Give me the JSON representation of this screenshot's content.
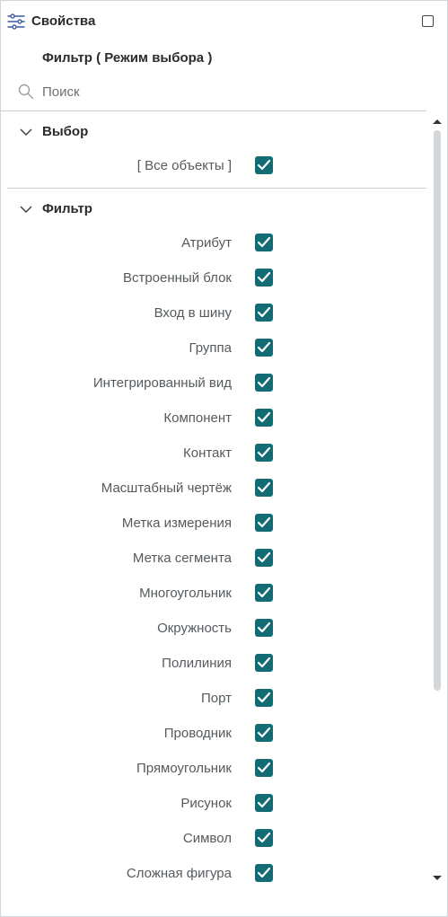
{
  "header": {
    "title": "Свойства",
    "subtitle": "Фильтр ( Режим выбора )"
  },
  "search": {
    "placeholder": "Поиск",
    "value": ""
  },
  "sections": {
    "selection": {
      "title": "Выбор",
      "items": [
        {
          "label": "[ Все объекты ]",
          "checked": true
        }
      ]
    },
    "filter": {
      "title": "Фильтр",
      "items": [
        {
          "label": "Атрибут",
          "checked": true
        },
        {
          "label": "Встроенный блок",
          "checked": true
        },
        {
          "label": "Вход в шину",
          "checked": true
        },
        {
          "label": "Группа",
          "checked": true
        },
        {
          "label": "Интегрированный вид",
          "checked": true
        },
        {
          "label": "Компонент",
          "checked": true
        },
        {
          "label": "Контакт",
          "checked": true
        },
        {
          "label": "Масштабный чертёж",
          "checked": true
        },
        {
          "label": "Метка измерения",
          "checked": true
        },
        {
          "label": "Метка сегмента",
          "checked": true
        },
        {
          "label": "Многоугольник",
          "checked": true
        },
        {
          "label": "Окружность",
          "checked": true
        },
        {
          "label": "Полилиния",
          "checked": true
        },
        {
          "label": "Порт",
          "checked": true
        },
        {
          "label": "Проводник",
          "checked": true
        },
        {
          "label": "Прямоугольник",
          "checked": true
        },
        {
          "label": "Рисунок",
          "checked": true
        },
        {
          "label": "Символ",
          "checked": true
        },
        {
          "label": "Сложная фигура",
          "checked": true
        }
      ]
    }
  },
  "colors": {
    "checkbox": "#136b73",
    "icon": "#3d5aa8"
  }
}
